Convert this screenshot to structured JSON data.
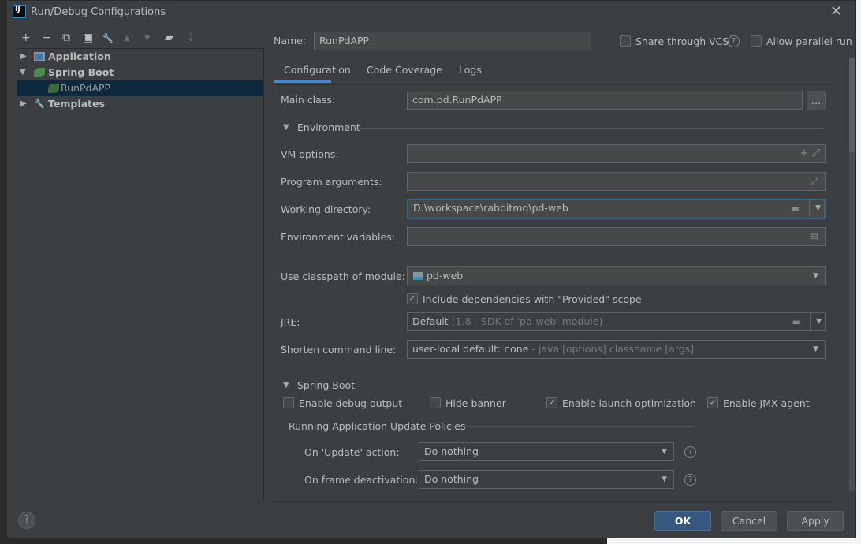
{
  "window": {
    "title": "Run/Debug Configurations",
    "logo": "IJ"
  },
  "toolbar": [
    {
      "icon": "plus-icon",
      "g": "+"
    },
    {
      "icon": "minus-icon",
      "g": "−"
    },
    {
      "icon": "copy-icon",
      "g": "⧉"
    },
    {
      "icon": "save-icon",
      "g": "▣"
    },
    {
      "icon": "wrench-icon",
      "g": "🔧"
    },
    {
      "icon": "arrow-up-icon",
      "g": "▲"
    },
    {
      "icon": "arrow-down-icon",
      "g": "▼"
    },
    {
      "icon": "new-folder-icon",
      "g": "▰"
    },
    {
      "icon": "sort-icon",
      "g": "⇣"
    }
  ],
  "tree": {
    "items": [
      {
        "label": "Application"
      },
      {
        "label": "Spring Boot"
      },
      {
        "label": "RunPdAPP"
      },
      {
        "label": "Templates"
      }
    ]
  },
  "name": {
    "label": "Name:",
    "value": "RunPdAPP",
    "share_vcs": "Share through VCS",
    "allow_parallel": "Allow parallel run"
  },
  "tabs": [
    {
      "label": "Configuration",
      "active": true
    },
    {
      "label": "Code Coverage"
    },
    {
      "label": "Logs"
    }
  ],
  "form": {
    "main_class": {
      "label": "Main class:",
      "value": "com.pd.RunPdAPP",
      "browse": "..."
    },
    "environment": "Environment",
    "vm_options": {
      "label": "VM options:",
      "value": ""
    },
    "program_args": {
      "label": "Program arguments:",
      "value": ""
    },
    "working_dir": {
      "label": "Working directory:",
      "value": "D:\\workspace\\rabbitmq\\pd-web"
    },
    "env_vars": {
      "label": "Environment variables:",
      "value": ""
    },
    "module": {
      "label": "Use classpath of module:",
      "value": "pd-web"
    },
    "include_provided": {
      "label": "Include dependencies with \"Provided\" scope",
      "checked": true
    },
    "jre": {
      "label": "JRE:",
      "value": "Default",
      "hint": "(1.8 - SDK of 'pd-web' module)"
    },
    "shorten": {
      "label": "Shorten command line:",
      "value": "user-local default: none",
      "hint": "- java [options] classname [args]"
    },
    "spring_boot": "Spring Boot",
    "debug_output": {
      "label": "Enable debug output",
      "checked": false
    },
    "hide_banner": {
      "label": "Hide banner",
      "checked": false
    },
    "launch_opt": {
      "label": "Enable launch optimization",
      "checked": true
    },
    "jmx": {
      "label": "Enable JMX agent",
      "checked": true
    },
    "policies": "Running Application Update Policies",
    "on_update": {
      "label": "On 'Update' action:",
      "value": "Do nothing"
    },
    "on_frame": {
      "label": "On frame deactivation:",
      "value": "Do nothing"
    }
  },
  "buttons": {
    "ok": "OK",
    "cancel": "Cancel",
    "apply": "Apply",
    "help": "?"
  },
  "colors": {
    "accent": "#4a88c7",
    "ok": "#365880",
    "selection": "#0d293e"
  }
}
